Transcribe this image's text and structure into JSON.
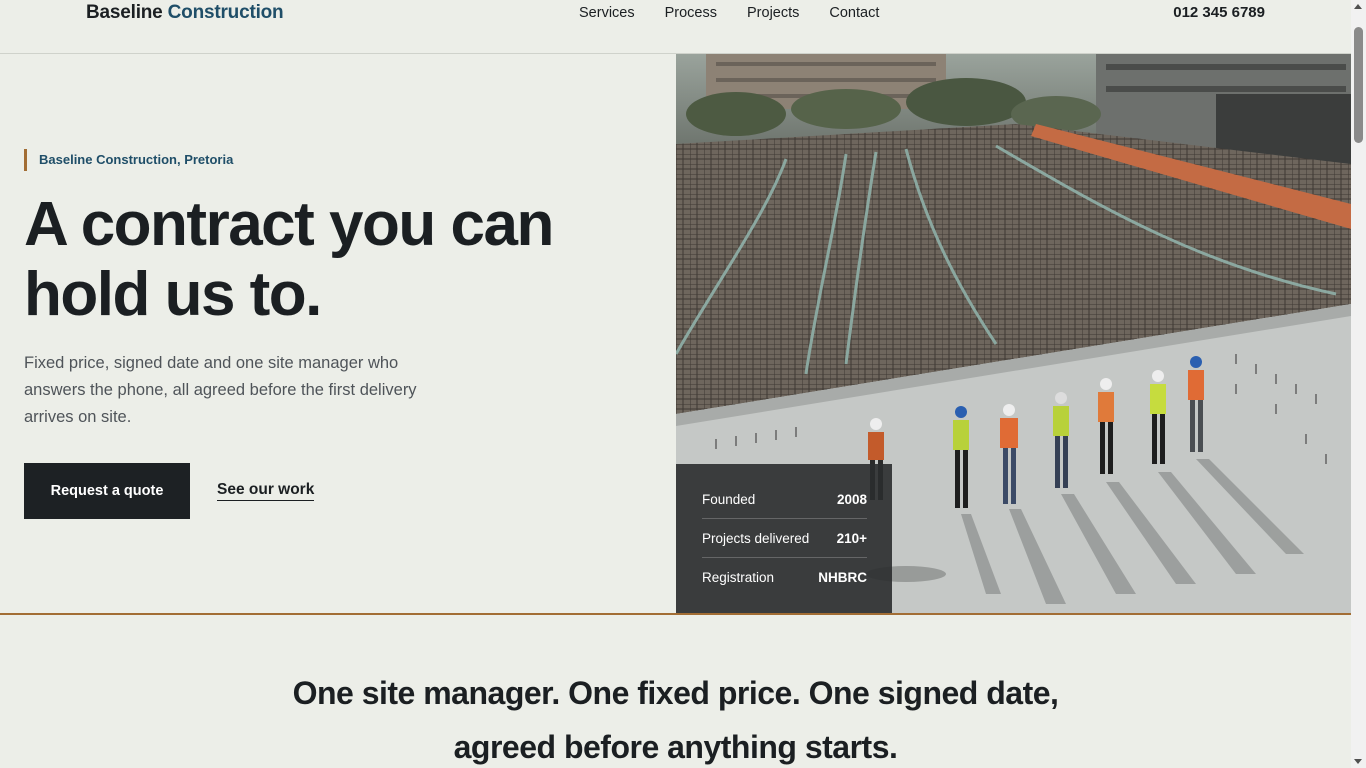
{
  "header": {
    "logo_part1": "Baseline",
    "logo_part2": "Construction",
    "nav": [
      "Services",
      "Process",
      "Projects",
      "Contact"
    ],
    "phone": "012 345 6789"
  },
  "hero": {
    "eyebrow": "Baseline Construction, Pretoria",
    "headline": "A contract you can hold us to.",
    "lede": "Fixed price, signed date and one site manager who answers the phone, all agreed before the first delivery arrives on site.",
    "cta_primary": "Request a quote",
    "cta_secondary": "See our work",
    "stats": [
      {
        "label": "Founded",
        "value": "2008"
      },
      {
        "label": "Projects delivered",
        "value": "210+"
      },
      {
        "label": "Registration",
        "value": "NHBRC"
      }
    ]
  },
  "statement": {
    "line1": "One site manager. One fixed price. One signed date,",
    "line2": "agreed before anything starts."
  },
  "colors": {
    "background": "#eceee8",
    "brand_blue": "#1f4e68",
    "accent_bronze": "#a26d34",
    "dark": "#1d2124"
  }
}
